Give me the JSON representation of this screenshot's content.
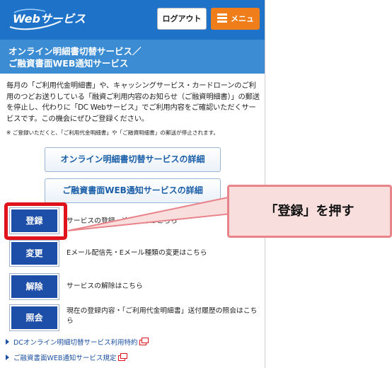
{
  "header": {
    "logo_text": "Webサービス",
    "logout_label": "ログアウト",
    "menu_label": "メニュー"
  },
  "title": {
    "line1": "オンライン明細書切替サービス／",
    "line2": "ご融資書面WEB通知サービス"
  },
  "intro_text": "毎月の「ご利用代金明細書」や、キャッシングサービス・カードローンのご利用のつどお送りしている「融資ご利用内容のお知らせ（ご融資明細書）」の郵送を停止し、代わりに「DC Webサービス」でご利用内容をご確認いただくサービスです。この機会にぜひご登録ください。",
  "note_text": "※ ご登録いただくと、「ご利用代金明細書」や「ご融資明細書」の郵送が停止されます。",
  "details": {
    "statement_label": "オンライン明細書切替サービスの詳細",
    "loan_label": "ご融資書面WEB通知サービスの詳細"
  },
  "actions": [
    {
      "label": "登録",
      "desc": "サービスの登録・追加登録はこちら"
    },
    {
      "label": "変更",
      "desc": "Eメール配信先・Eメール種類の変更はこちら"
    },
    {
      "label": "解除",
      "desc": "サービスの解除はこちら"
    },
    {
      "label": "照会",
      "desc": "現在の登録内容・「ご利用代金明細書」送付履歴の照会はこちら"
    }
  ],
  "links": [
    "DCオンライン明細切替サービス利用特約",
    "ご融資書面WEB通知サービス規定"
  ],
  "callout_text": "「登録」を押す",
  "colors": {
    "header_bg": "#1e73c9",
    "title_bg": "#3c8cd4",
    "menu_orange": "#ef7d1a",
    "action_blue": "#1e4fa8",
    "highlight_red": "#e0121b",
    "callout_bg": "#f9dede"
  }
}
